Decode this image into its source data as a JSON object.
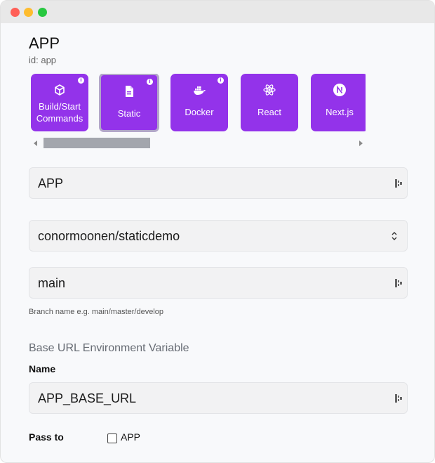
{
  "app": {
    "title": "APP",
    "id_label": "id: app"
  },
  "build_types": [
    {
      "label": "Build/Start Commands",
      "icon": "box-icon",
      "has_info": true,
      "selected": false
    },
    {
      "label": "Static",
      "icon": "file-icon",
      "has_info": true,
      "selected": true
    },
    {
      "label": "Docker",
      "icon": "docker-icon",
      "has_info": true,
      "selected": false
    },
    {
      "label": "React",
      "icon": "react-icon",
      "has_info": false,
      "selected": false
    },
    {
      "label": "Next.js",
      "icon": "nextjs-icon",
      "has_info": false,
      "selected": false
    }
  ],
  "colors": {
    "accent": "#9333ea",
    "selected_border": "#b2a6c9"
  },
  "form": {
    "name_value": "APP",
    "repo_value": "conormoonen/staticdemo",
    "branch_value": "main",
    "branch_hint": "Branch name e.g. main/master/develop",
    "base_url_section": "Base URL Environment Variable",
    "env_name_label": "Name",
    "env_name_value": "APP_BASE_URL",
    "pass_to_label": "Pass to",
    "pass_to_option": "APP"
  }
}
